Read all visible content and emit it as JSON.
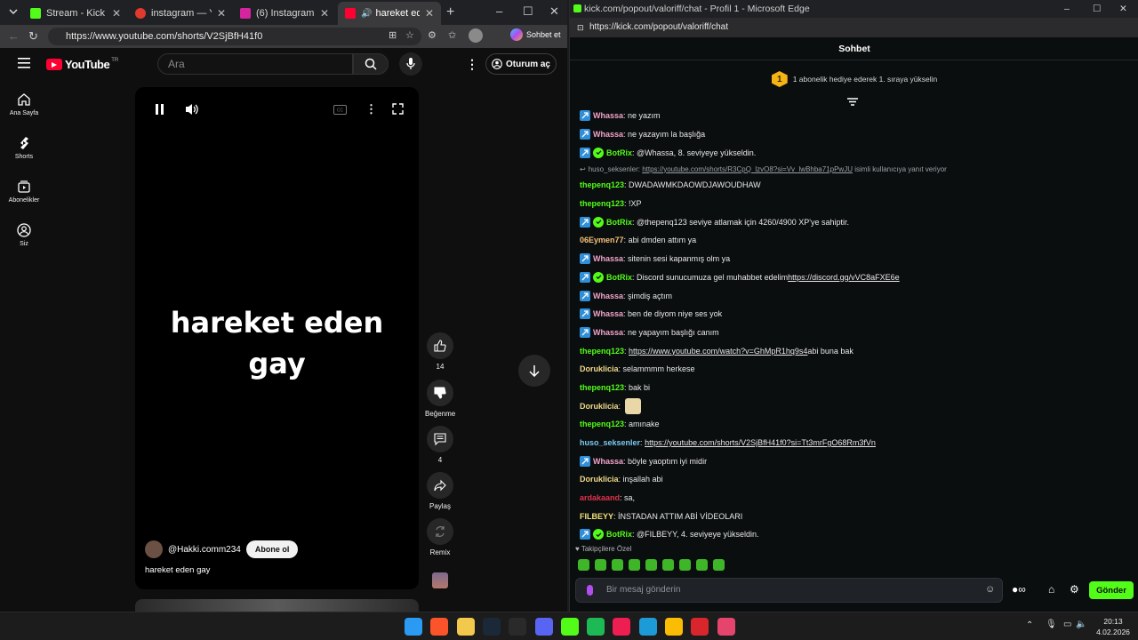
{
  "left_browser": {
    "tabs": [
      {
        "title": "Stream - Kick Dashboard",
        "icon": "kick-icon",
        "color": "#53fc18",
        "active": false
      },
      {
        "title": "instagram — Yandex",
        "icon": "yandex-icon",
        "color": "#e03a2e",
        "active": false
      },
      {
        "title": "(6) Instagram",
        "icon": "instagram-icon",
        "color": "#d6249f",
        "active": false
      },
      {
        "title": "hareket eden gay",
        "icon": "youtube-icon",
        "color": "#ff0033",
        "active": true
      }
    ],
    "url": "https://www.youtube.com/shorts/V2SjBfH41f0",
    "copilot_label": "Sohbet et"
  },
  "youtube": {
    "logo_text": "YouTube",
    "region": "TR",
    "search_placeholder": "Ara",
    "signin_label": "Oturum aç",
    "sidebar": [
      {
        "label": "Ana Sayfa",
        "icon": "home-icon"
      },
      {
        "label": "Shorts",
        "icon": "shorts-icon"
      },
      {
        "label": "Abonelikler",
        "icon": "subscriptions-icon"
      },
      {
        "label": "Siz",
        "icon": "user-icon"
      }
    ],
    "video": {
      "overlay_text_line1": "hareket eden",
      "overlay_text_line2": "gay",
      "channel": "@Hakki.comm234",
      "subscribe_label": "Abone ol",
      "caption": "hareket eden gay"
    },
    "actions": {
      "like_count": "14",
      "dislike_label": "Beğenme",
      "comment_count": "4",
      "share_label": "Paylaş",
      "remix_label": "Remix"
    }
  },
  "right_browser": {
    "window_title": "kick.com/popout/valoriff/chat - Profil 1 - Microsoft Edge",
    "url": "https://kick.com/popout/valoriff/chat",
    "chat_title": "Sohbet",
    "gift_rank": "1",
    "gift_banner": "1 abonelik hediye ederek 1. sıraya yükselin",
    "messages": [
      {
        "user": "Whassa",
        "color": "#f0a3c9",
        "badge": "sub",
        "text": "ne yazım"
      },
      {
        "user": "Whassa",
        "color": "#f0a3c9",
        "badge": "sub",
        "text": "ne yazayım la başlığa"
      },
      {
        "user": "BotRix",
        "color": "#53fc18",
        "badge": "bot",
        "text": "@Whassa, 8. seviyeye yükseldin."
      },
      {
        "reply": true,
        "reply_user": "huso_seksenler",
        "reply_link": "https://youtube.com/shorts/R3CpQ_lzvO8?si=Vv_lwBhba71pPwJU",
        "reply_suffix": "isimli kullanıcıya yanıt veriyor"
      },
      {
        "user": "thepenq123",
        "color": "#53fc18",
        "badge": "none",
        "text": "DWADAWMKDAOWDJAWOUDHAW"
      },
      {
        "user": "thepenq123",
        "color": "#53fc18",
        "badge": "none",
        "text": "!XP"
      },
      {
        "user": "BotRix",
        "color": "#53fc18",
        "badge": "bot",
        "text": "@thepenq123 seviye atlamak için 4260/4900 XP'ye sahiptir."
      },
      {
        "user": "06Eymen77",
        "color": "#f3c07a",
        "badge": "none",
        "text": "abi dmden attım ya"
      },
      {
        "user": "Whassa",
        "color": "#f0a3c9",
        "badge": "sub",
        "text": "sitenin sesi kapanmış olm ya"
      },
      {
        "user": "BotRix",
        "color": "#53fc18",
        "badge": "bot",
        "text": "Discord sunucumuza gel muhabbet edelim ",
        "link": "https://discord.gg/vVC8aFXE6e"
      },
      {
        "user": "Whassa",
        "color": "#f0a3c9",
        "badge": "sub",
        "text": "şimdiş açtım"
      },
      {
        "user": "Whassa",
        "color": "#f0a3c9",
        "badge": "sub",
        "text": "ben de diyom niye ses yok"
      },
      {
        "user": "Whassa",
        "color": "#f0a3c9",
        "badge": "sub",
        "text": "ne yapayım başlığı canım"
      },
      {
        "user": "thepenq123",
        "color": "#53fc18",
        "badge": "none",
        "text": "",
        "link": "https://www.youtube.com/watch?v=GhMpR1hq9s4",
        "after": " abi buna bak"
      },
      {
        "user": "Doruklicia",
        "color": "#f0d98a",
        "badge": "none",
        "text": "selammmm herkese"
      },
      {
        "user": "thepenq123",
        "color": "#53fc18",
        "badge": "none",
        "text": "bak bi"
      },
      {
        "user": "Doruklicia",
        "color": "#f0d98a",
        "badge": "none",
        "text": "",
        "emote": true
      },
      {
        "user": "thepenq123",
        "color": "#53fc18",
        "badge": "none",
        "text": "amınake"
      },
      {
        "user": "huso_seksenler",
        "color": "#7ec8f2",
        "badge": "none",
        "text": "",
        "link": "https://youtube.com/shorts/V2SjBfH41f0?si=Tt3mrFgO68Rm3fVn"
      },
      {
        "user": "Whassa",
        "color": "#f0a3c9",
        "badge": "sub",
        "text": "böyle yaoptım iyi midir"
      },
      {
        "user": "Doruklicia",
        "color": "#f0d98a",
        "badge": "none",
        "text": "inşallah abi"
      },
      {
        "user": "ardakaand",
        "color": "#e0314b",
        "badge": "none",
        "text": "sa,"
      },
      {
        "user": "FILBEYY",
        "color": "#f3e27a",
        "badge": "none",
        "text": "İNSTADAN ATTIM ABİ VİDEOLARI"
      },
      {
        "user": "BotRix",
        "color": "#53fc18",
        "badge": "bot",
        "text": "@FILBEYY, 4. seviyeye yükseldin."
      }
    ],
    "follower_label": "Takipçilere Özel",
    "input_placeholder": "Bir mesaj gönderin",
    "send_label": "Gönder"
  },
  "taskbar": {
    "time": "20:13",
    "date": "4.02.2026",
    "apps": [
      {
        "icon": "windows-start-icon",
        "color": "#2b9af3"
      },
      {
        "icon": "brave-icon",
        "color": "#fb542b"
      },
      {
        "icon": "file-explorer-icon",
        "color": "#f2c94c"
      },
      {
        "icon": "steam-icon",
        "color": "#1b2838"
      },
      {
        "icon": "epic-games-icon",
        "color": "#2a2a2a"
      },
      {
        "icon": "discord-icon",
        "color": "#5865f2"
      },
      {
        "icon": "kick-app-icon",
        "color": "#53fc18"
      },
      {
        "icon": "spotify-icon",
        "color": "#1db954"
      },
      {
        "icon": "tiktok-icon",
        "color": "#ee1d52"
      },
      {
        "icon": "edge-icon",
        "color": "#1d9bd6"
      },
      {
        "icon": "chrome-icon",
        "color": "#fbbc04"
      },
      {
        "icon": "app-red-icon",
        "color": "#d9252c"
      },
      {
        "icon": "app-pink-icon",
        "color": "#e5446d"
      }
    ]
  }
}
